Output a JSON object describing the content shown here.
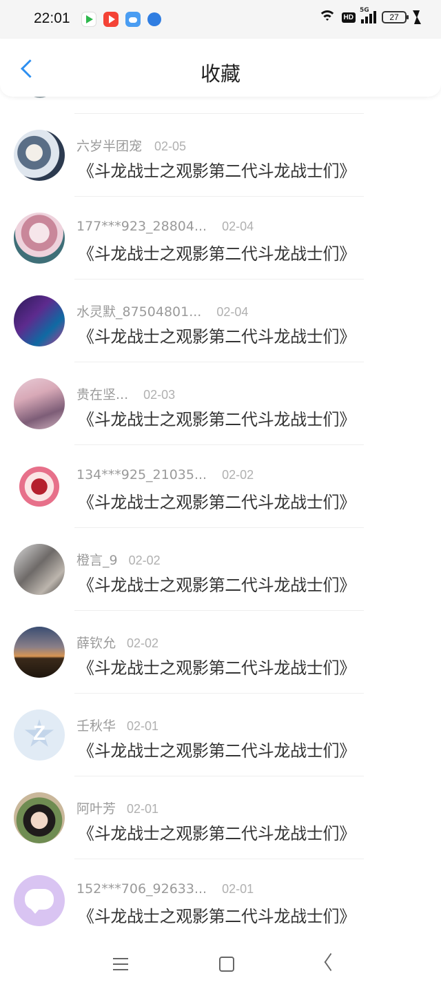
{
  "status_bar": {
    "time": "22:01",
    "network_label": "5G",
    "hd_label": "HD",
    "battery": "27",
    "icons": [
      "app-store-icon",
      "video-app-icon",
      "cloud-app-icon",
      "browser-app-icon",
      "wifi-icon",
      "hd-icon",
      "signal-icon",
      "battery-icon",
      "charging-icon"
    ]
  },
  "header": {
    "title": "收藏",
    "back_icon": "chevron-left-icon",
    "accent_color": "#2e8ff0"
  },
  "items": [
    {
      "user": "六岁半团宠",
      "date": "02-05",
      "content": "《斗龙战士之观影第二代斗龙战士们》"
    },
    {
      "user": "177***923_28804...",
      "date": "02-04",
      "content": "《斗龙战士之观影第二代斗龙战士们》"
    },
    {
      "user": "水灵默_87504801...",
      "date": "02-04",
      "content": "《斗龙战士之观影第二代斗龙战士们》"
    },
    {
      "user": "贵在坚...",
      "date": "02-03",
      "content": "《斗龙战士之观影第二代斗龙战士们》"
    },
    {
      "user": "134***925_21035...",
      "date": "02-02",
      "content": "《斗龙战士之观影第二代斗龙战士们》"
    },
    {
      "user": "橙言_9",
      "date": "02-02",
      "content": "《斗龙战士之观影第二代斗龙战士们》"
    },
    {
      "user": "薛钦允",
      "date": "02-02",
      "content": "《斗龙战士之观影第二代斗龙战士们》"
    },
    {
      "user": "壬秋华",
      "date": "02-01",
      "content": "《斗龙战士之观影第二代斗龙战士们》"
    },
    {
      "user": "阿叶芳",
      "date": "02-01",
      "content": "《斗龙战士之观影第二代斗龙战士们》"
    },
    {
      "user": "152***706_92633...",
      "date": "02-01",
      "content": "《斗龙战士之观影第二代斗龙战士们》"
    }
  ],
  "nav": {
    "icons": [
      "menu-icon",
      "home-icon",
      "back-triangle-icon"
    ]
  }
}
